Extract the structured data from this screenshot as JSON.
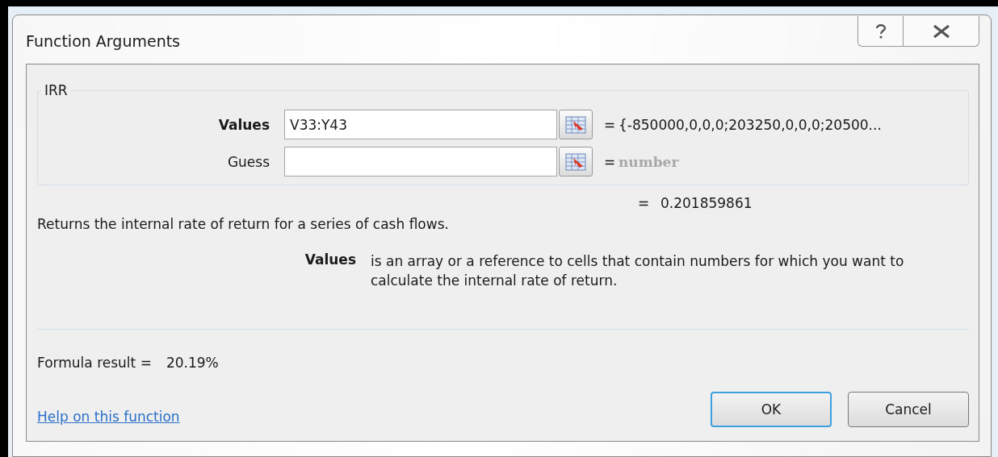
{
  "window": {
    "title": "Function Arguments"
  },
  "function": {
    "name": "IRR",
    "arguments": [
      {
        "name": "Values",
        "required": true,
        "value": "V33:Y43",
        "equals": "=",
        "result": "{-850000,0,0,0;203250,0,0,0;20500...",
        "dimmed": false
      },
      {
        "name": "Guess",
        "required": false,
        "equals": "=",
        "result": "number",
        "dimmed": true
      }
    ],
    "result_equals": "=",
    "result": "0.201859861"
  },
  "description": "Returns the internal rate of return for a series of cash flows.",
  "argument_help": {
    "name": "Values",
    "text": "is an array or a reference to cells that contain numbers for which you want to calculate the internal rate of return."
  },
  "formula_result": {
    "label": "Formula result =",
    "value": "20.19%"
  },
  "help_link": "Help on this function",
  "buttons": [
    {
      "label": "OK",
      "default": true
    },
    {
      "label": "Cancel",
      "default": false
    }
  ]
}
